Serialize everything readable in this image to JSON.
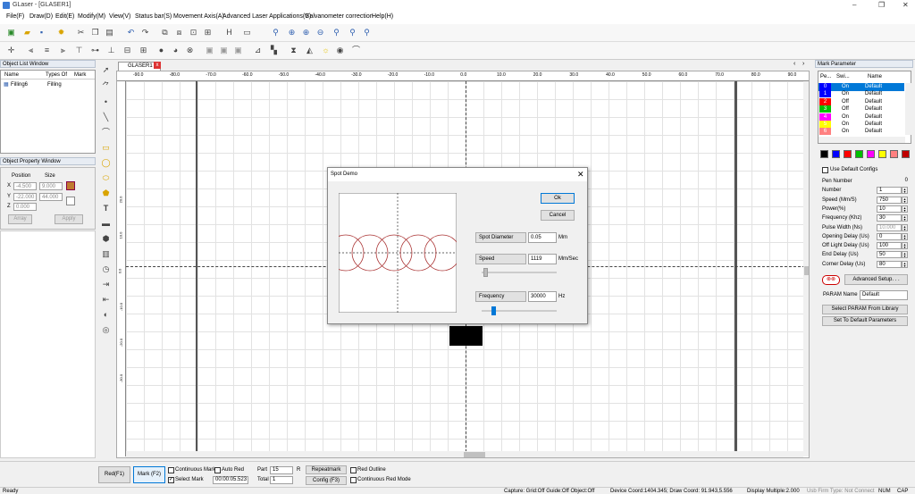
{
  "window": {
    "title": "GLaser - [GLASER1]"
  },
  "menu": [
    "File(F)",
    "Draw(D)",
    "Edit(E)",
    "Modify(M)",
    "View(V)",
    "Status bar(S)",
    "Movement Axis(A)",
    "Advanced Laser Applications(Y)",
    "Galvanometer correction",
    "Help(H)"
  ],
  "doc_tab": "GLASER1",
  "object_list": {
    "title": "Object List Window",
    "columns": [
      "Name",
      "Types Of",
      "Mark"
    ],
    "rows": [
      {
        "name": "Filling6",
        "type": "Filling",
        "mark": ""
      }
    ]
  },
  "object_property": {
    "title": "Object Property Window",
    "position_label": "Position",
    "size_label": "Size",
    "x_label": "X",
    "x_pos": "-4.500",
    "x_size": "9.000",
    "y_label": "Y",
    "y_pos": "-22.000",
    "y_size": "44.000",
    "z_label": "Z",
    "z_pos": "0.000",
    "array": "Array",
    "apply": "Apply"
  },
  "ruler": {
    "top": [
      "-90.0",
      "-80.0",
      "-70.0",
      "-60.0",
      "-50.0",
      "-40.0",
      "-30.0",
      "-20.0",
      "-10.0",
      "0.0",
      "10.0",
      "20.0",
      "30.0",
      "40.0",
      "50.0",
      "60.0",
      "70.0",
      "80.0",
      "90.0"
    ],
    "left": [
      "20.0",
      "10.0",
      "0.0",
      "-10.0",
      "-20.0",
      "-30.0"
    ]
  },
  "dialog": {
    "title": "Spot Demo",
    "ok": "Ok",
    "cancel": "Cancel",
    "spot_diameter_label": "Spot Diameter",
    "spot_diameter": "0.05",
    "spot_unit": "Mm",
    "speed_label": "Speed",
    "speed": "1119",
    "speed_unit": "Mm/Sec",
    "frequency_label": "Frequency",
    "frequency": "30000",
    "freq_unit": "Hz",
    "speed_level": 0.05,
    "freq_level": 0.15
  },
  "mark_param": {
    "title": "Mark Parameter",
    "columns": [
      "Pe...",
      "Swi...",
      "Name"
    ],
    "pens": [
      {
        "pen": "0",
        "sw": "On",
        "name": "Default",
        "color": "#0000ff"
      },
      {
        "pen": "1",
        "sw": "On",
        "name": "Default",
        "color": "#0000ff"
      },
      {
        "pen": "2",
        "sw": "Off",
        "name": "Default",
        "color": "#ff0000"
      },
      {
        "pen": "3",
        "sw": "Off",
        "name": "Default",
        "color": "#00c000"
      },
      {
        "pen": "4",
        "sw": "On",
        "name": "Default",
        "color": "#ff00ff"
      },
      {
        "pen": "5",
        "sw": "On",
        "name": "Default",
        "color": "#ffff00"
      },
      {
        "pen": "6",
        "sw": "On",
        "name": "Default",
        "color": "#ff8080"
      }
    ],
    "swatches": [
      "#000000",
      "#0000ff",
      "#ff0000",
      "#00c000",
      "#ff00ff",
      "#ffff00",
      "#ff8080",
      "#c00000"
    ],
    "use_default": "Use Default Configs",
    "params": [
      {
        "label": "Pen Number",
        "value": "0"
      },
      {
        "label": "Number",
        "value": "1"
      },
      {
        "label": "Speed (Mm/S)",
        "value": "750"
      },
      {
        "label": "Power(%)",
        "value": "10"
      },
      {
        "label": "Frequency (Khz)",
        "value": "30"
      },
      {
        "label": "Pulse Width (Ns)",
        "value": "10.000"
      },
      {
        "label": "Opening Delay (Us)",
        "value": "0"
      },
      {
        "label": "Off Light Delay (Us)",
        "value": "100"
      },
      {
        "label": "End Delay (Us)",
        "value": "50"
      },
      {
        "label": "Corner Delay (Us)",
        "value": "80"
      }
    ],
    "advanced": "Advanced Setup. . .",
    "param_name_label": "PARAM Name",
    "param_name": "Default",
    "select_param": "Select PARAM From Library",
    "set_default": "Set To Default Parameters"
  },
  "bottom": {
    "red": "Red(F1)",
    "mark": "Mark (F2)",
    "continuous_mark": "Continuous Mark",
    "auto_red": "Auto Red",
    "select_mark": "Select Mark",
    "time": "00:00:05.523",
    "part_label": "Part",
    "part": "15",
    "r": "R",
    "total_label": "Total",
    "total": "1",
    "repeatmark": "Repeatmark",
    "config": "Config (F3)",
    "red_outline": "Red Outline",
    "continuous_red": "Continuous Red Mode"
  },
  "status": {
    "left": "Ready",
    "capture": "Capture: Grid:Off Guide:Off Object:Off",
    "coords": "Device Coord:1404.345; Draw Coord: 91.943,5.556",
    "display": "Display Multiple:2.000",
    "firm": "Usb Firm Type: Not Connect",
    "num": "NUM",
    "cap": "CAP"
  }
}
